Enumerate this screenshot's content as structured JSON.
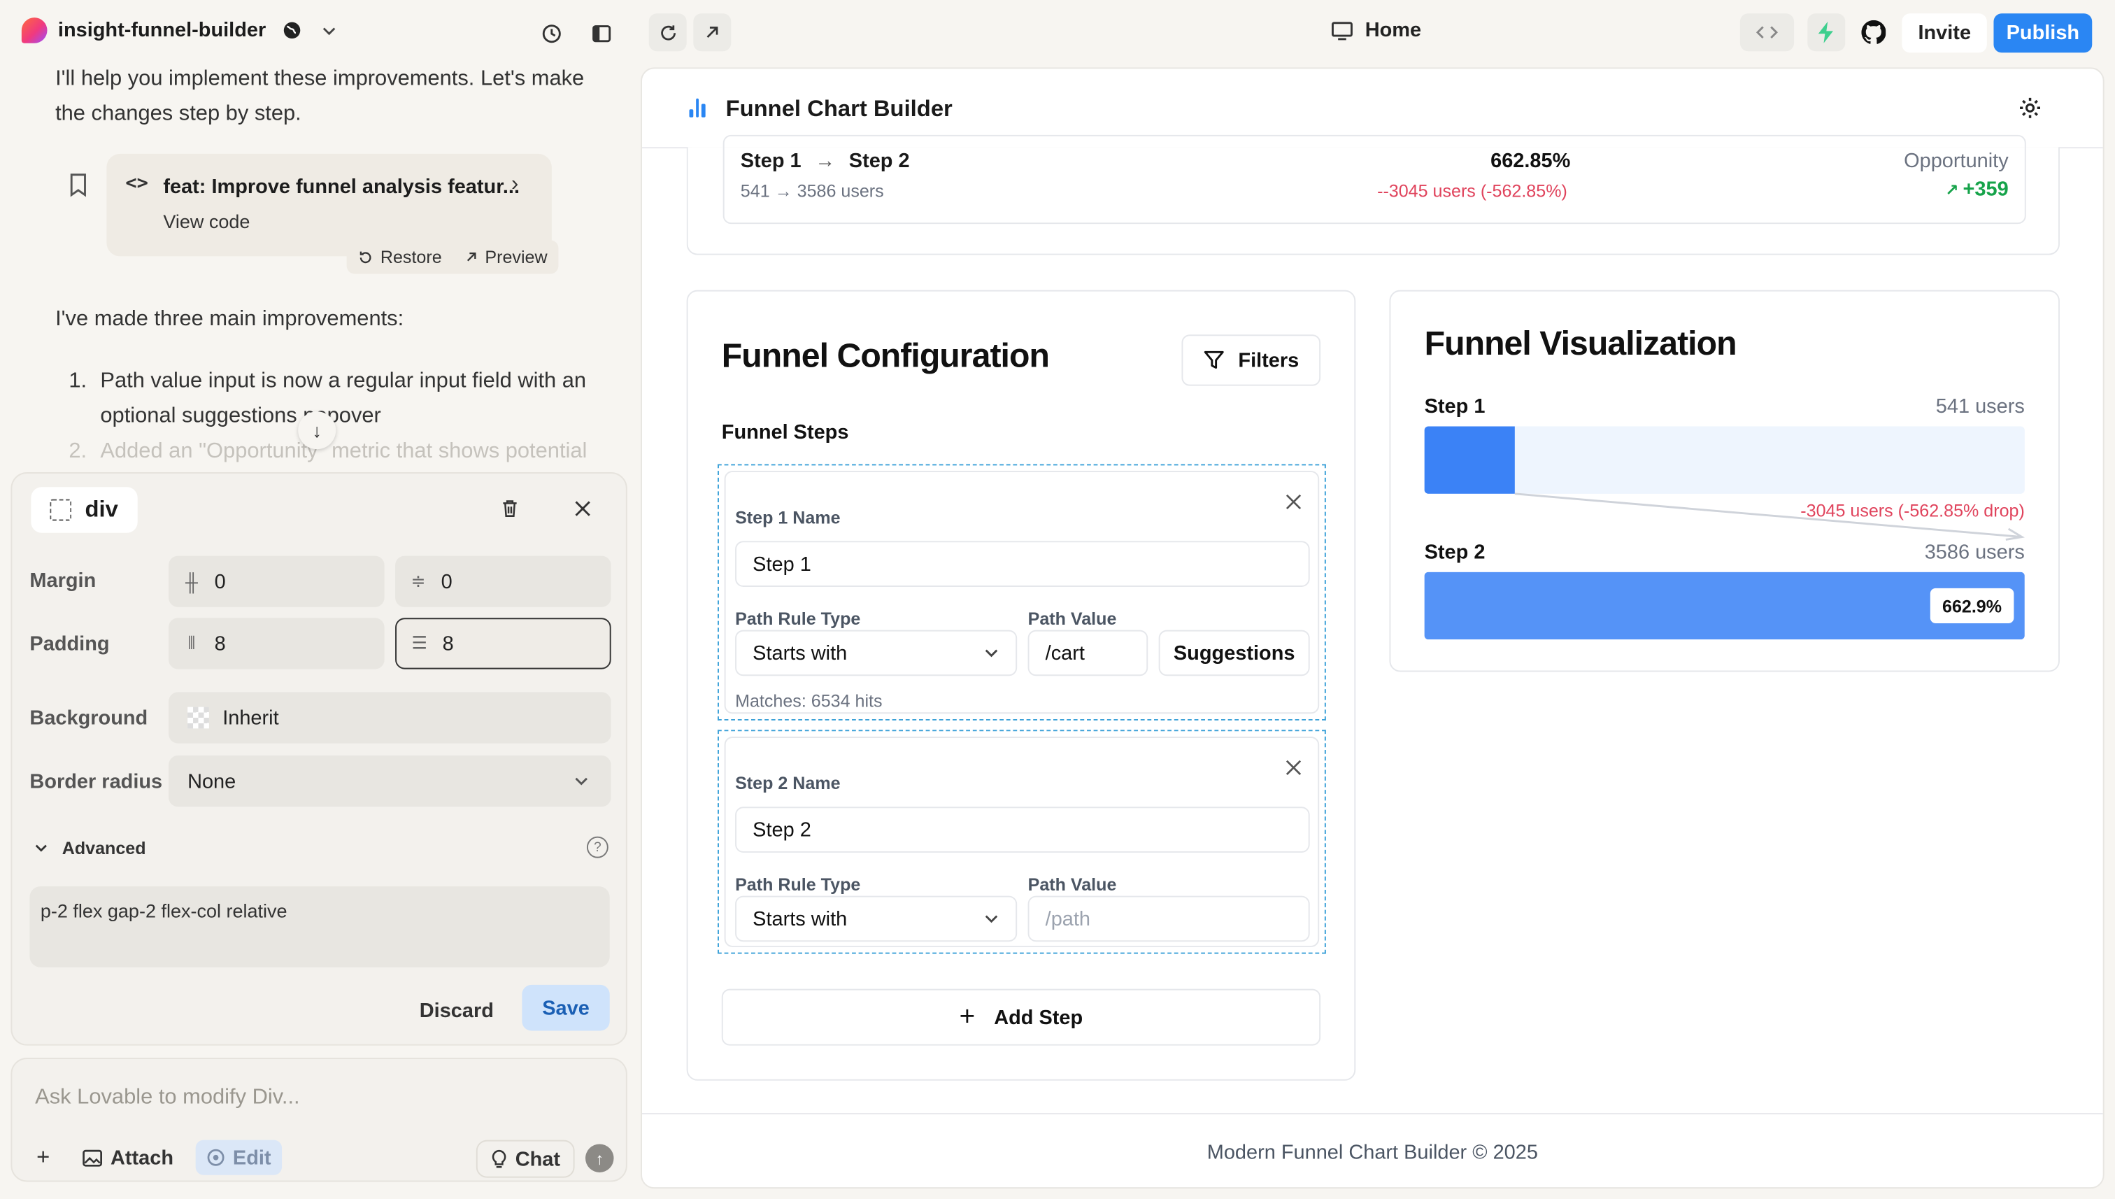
{
  "topbar": {
    "project_name": "insight-funnel-builder",
    "home_tab": "Home",
    "invite": "Invite",
    "publish": "Publish"
  },
  "chat": {
    "message1": "I'll help you implement these improvements. Let's make the changes step by step.",
    "commit": {
      "title": "feat: Improve funnel analysis featur...",
      "view_code": "View code",
      "restore": "Restore",
      "preview": "Preview"
    },
    "message2": "I've made three main improvements:",
    "list": [
      {
        "num": "1.",
        "text": "Path value input is now a regular input field with an optional suggestions popover"
      },
      {
        "num": "2.",
        "text": "Added an \"Opportunity\" metric that shows potential"
      }
    ]
  },
  "panel": {
    "element": "div",
    "margin_label": "Margin",
    "margin_x": "0",
    "margin_y": "0",
    "padding_label": "Padding",
    "padding_x": "8",
    "padding_y": "8",
    "background_label": "Background",
    "background_value": "Inherit",
    "radius_label": "Border radius",
    "radius_value": "None",
    "advanced_label": "Advanced",
    "classes": "p-2 flex gap-2 flex-col relative",
    "discard": "Discard",
    "save": "Save"
  },
  "prompt": {
    "placeholder": "Ask Lovable to modify Div...",
    "attach": "Attach",
    "edit": "Edit",
    "chat": "Chat"
  },
  "app": {
    "title": "Funnel Chart Builder",
    "summary": {
      "title_from": "Step 1",
      "title_to": "Step 2",
      "sub": "541 → 3586 users",
      "pct": "662.85%",
      "drop": "--3045 users (-562.85%)",
      "opp_label": "Opportunity",
      "opp_value": "+359"
    },
    "config": {
      "title": "Funnel Configuration",
      "filters": "Filters",
      "steps_label": "Funnel Steps",
      "steps": [
        {
          "name_label": "Step 1 Name",
          "name": "Step 1",
          "rule_label": "Path Rule Type",
          "rule": "Starts with",
          "value_label": "Path Value",
          "value": "/cart",
          "suggestions": "Suggestions",
          "matches": "Matches: 6534 hits"
        },
        {
          "name_label": "Step 2 Name",
          "name": "Step 2",
          "rule_label": "Path Rule Type",
          "rule": "Starts with",
          "value_label": "Path Value",
          "value_placeholder": "/path"
        }
      ],
      "add_step": "Add Step"
    },
    "viz": {
      "title": "Funnel Visualization",
      "step1_label": "Step 1",
      "step1_users": "541 users",
      "step1_fill": 0.15,
      "drop": "-3045 users (-562.85% drop)",
      "step2_label": "Step 2",
      "step2_users": "3586 users",
      "step2_fill": 1.0,
      "step2_pct": "662.9%"
    },
    "footer": "Modern Funnel Chart Builder © 2025"
  },
  "colors": {
    "accent": "#2a86f3",
    "bar": "#3b82f6",
    "danger": "#e0435c",
    "success": "#16a34a"
  }
}
